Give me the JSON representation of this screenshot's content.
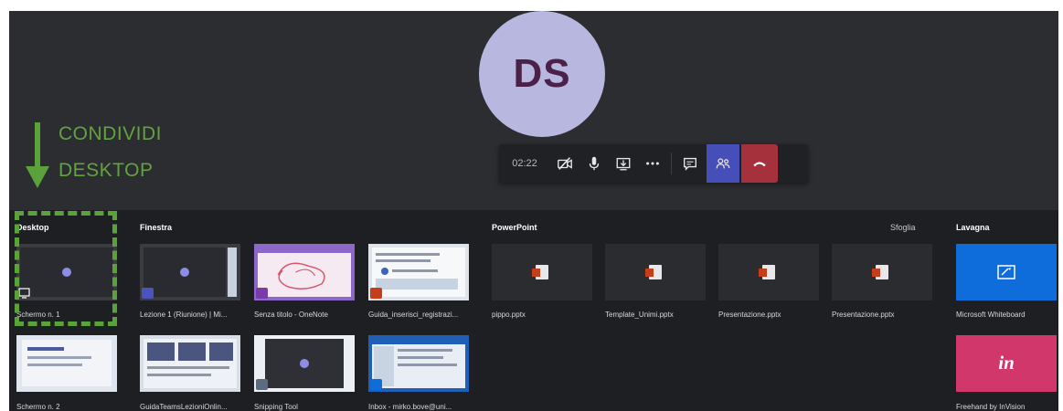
{
  "annotation": {
    "line1": "CONDIVIDI",
    "line2": "DESKTOP",
    "color": "#62a33f"
  },
  "avatar": {
    "initials": "DS",
    "bg": "#b8b7df",
    "fg": "#4b2147"
  },
  "call_bar": {
    "timer": "02:22",
    "buttons": [
      "camera-off-icon",
      "microphone-icon",
      "share-tray-icon",
      "more-options-icon",
      "chat-icon",
      "participants-icon",
      "hang-up-icon"
    ],
    "participants_bg": "#464eb8",
    "hangup_bg": "#a4313c"
  },
  "tray": {
    "sections": {
      "desktop": "Desktop",
      "window": "Finestra",
      "powerpoint": "PowerPoint",
      "browse": "Sfoglia",
      "whiteboard": "Lavagna"
    },
    "desktop_items": [
      "Schermo n. 1",
      "Schermo n. 2"
    ],
    "window_items": [
      "Lezione 1 (Riunione) | Mi...",
      "Senza titolo - OneNote",
      "Guida_inserisci_registrazi...",
      "GuidaTeamsLezioniOnlin...",
      "Snipping Tool",
      "Inbox - mirko.bove@uni..."
    ],
    "ppt_items": [
      "pippo.pptx",
      "Template_Unimi.pptx",
      "Presentazione.pptx",
      "Presentazione.pptx"
    ],
    "whiteboard_items": [
      {
        "label": "Microsoft Whiteboard",
        "color": "#0f6cdb",
        "glyph": ""
      },
      {
        "label": "Freehand by InVision",
        "color": "#d1376a",
        "glyph": "in"
      }
    ]
  }
}
